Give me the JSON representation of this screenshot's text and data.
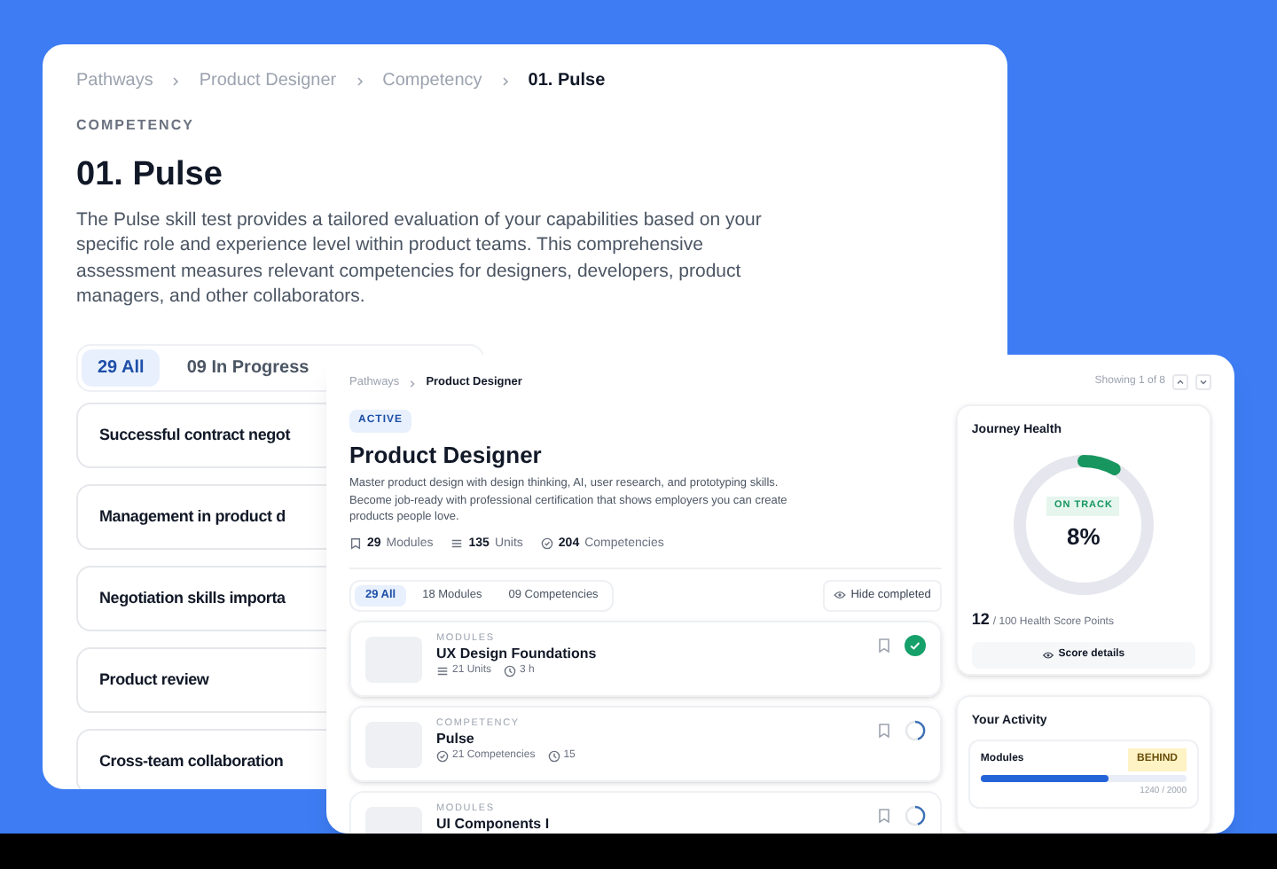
{
  "back_page": {
    "breadcrumb": [
      "Pathways",
      "Product Designer",
      "Competency",
      "01. Pulse"
    ],
    "eyebrow": "COMPETENCY",
    "title": "01. Pulse",
    "description": "The Pulse skill test provides a tailored evaluation of your capabilities based on your specific role and experience level within product teams. This comprehensive assessment measures relevant competencies for designers, developers, product managers, and other collaborators.",
    "tabs": [
      {
        "label": "29 All",
        "selected": true
      },
      {
        "label": "09 In Progress",
        "selected": false
      }
    ],
    "items": [
      "Successful contract negot",
      "Management in product d",
      "Negotiation skills importa",
      "Product review",
      "Cross-team collaboration"
    ]
  },
  "front_page": {
    "breadcrumb": [
      "Pathways",
      "Product Designer"
    ],
    "pager": {
      "text": "Showing 1 of 8"
    },
    "badge": "ACTIVE",
    "title": "Product Designer",
    "description": "Master product design with design thinking, AI, user research, and prototyping skills. Become job-ready with professional certification that shows employers you can create products people love.",
    "stats": [
      {
        "kind": "modules",
        "value": "29",
        "label": "Modules"
      },
      {
        "kind": "units",
        "value": "135",
        "label": "Units"
      },
      {
        "kind": "competencies",
        "value": "204",
        "label": "Competencies"
      }
    ],
    "tabs": [
      {
        "label": "29 All",
        "selected": true
      },
      {
        "label": "18 Modules",
        "selected": false
      },
      {
        "label": "09 Competencies",
        "selected": false
      }
    ],
    "hide_completed": "Hide completed",
    "items": [
      {
        "category": "MODULES",
        "title": "UX Design Foundations",
        "meta": [
          {
            "kind": "units",
            "text": "21 Units"
          },
          {
            "kind": "time",
            "text": "3 h"
          }
        ],
        "kind": "done"
      },
      {
        "category": "COMPETENCY",
        "title": "Pulse",
        "meta": [
          {
            "kind": "competencies",
            "text": "21 Competencies"
          },
          {
            "kind": "time",
            "text": "15"
          }
        ],
        "kind": "in_progress"
      },
      {
        "category": "MODULES",
        "title": "UI Components I",
        "kind": "in_progress"
      }
    ],
    "journey_health": {
      "title": "Journey Health",
      "level": 0.08,
      "badge": "ON TRACK",
      "percent": "8%",
      "points": "12",
      "points_label": "/ 100 Health Score Points",
      "button": "Score details"
    },
    "activity": {
      "title": "Your Activity",
      "label": "Modules",
      "badge": "BEHIND",
      "level": 0.62,
      "reading": "1240 / 2000"
    }
  }
}
